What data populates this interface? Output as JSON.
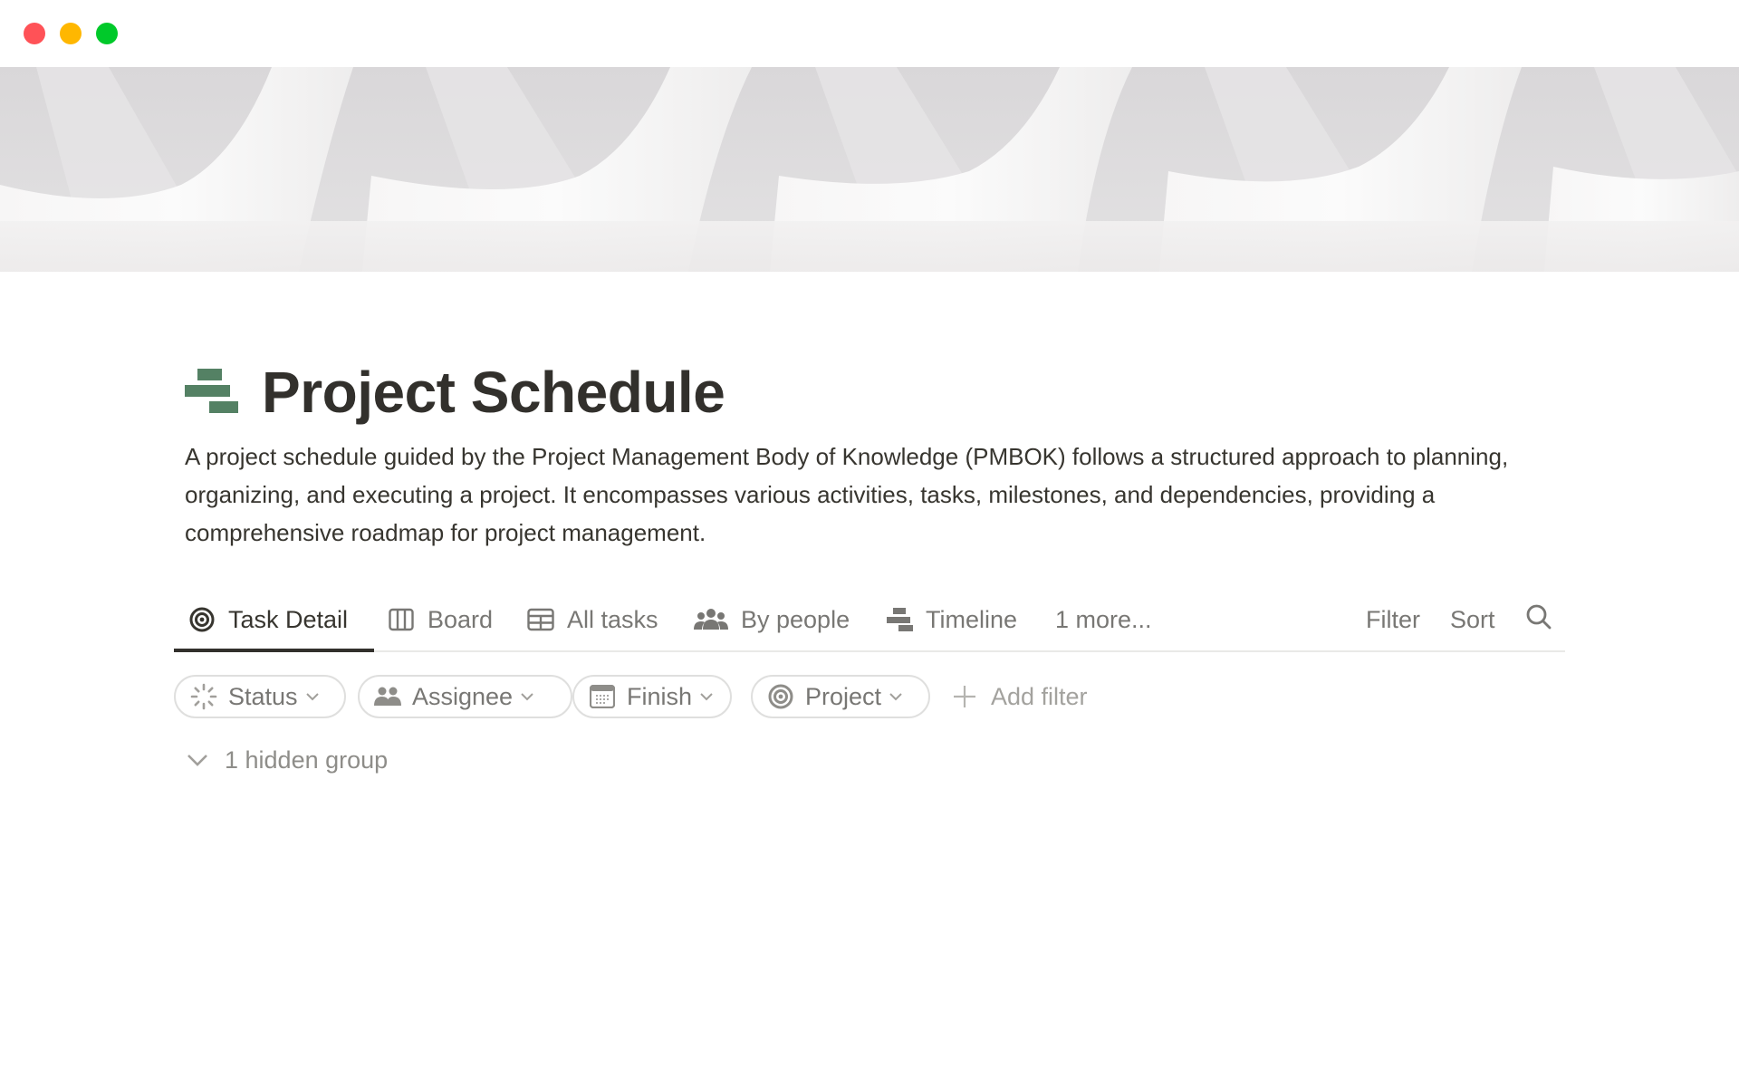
{
  "window": {
    "controls": [
      "close",
      "minimize",
      "maximize"
    ],
    "colors": {
      "close": "#ff5257",
      "minimize": "#ffb700",
      "maximize": "#00c92a"
    }
  },
  "cover": {
    "description": "White abstract sculptural arches"
  },
  "page": {
    "icon": "timeline-bars-icon",
    "icon_color": "#548164",
    "title": "Project Schedule",
    "description": "A project schedule guided by the Project Management Body of Knowledge (PMBOK) follows a structured approach to planning, organizing, and executing a project. It encompasses various activities, tasks, milestones, and dependencies, providing a comprehensive roadmap for project management."
  },
  "views": {
    "tabs": [
      {
        "label": "Task Detail",
        "icon": "target-icon",
        "active": true
      },
      {
        "label": "Board",
        "icon": "board-columns-icon",
        "active": false
      },
      {
        "label": "All tasks",
        "icon": "table-icon",
        "active": false
      },
      {
        "label": "By people",
        "icon": "people-icon",
        "active": false
      },
      {
        "label": "Timeline",
        "icon": "timeline-icon",
        "active": false
      }
    ],
    "more_label": "1 more...",
    "actions": {
      "filter": "Filter",
      "sort": "Sort",
      "search_icon": "search-icon"
    }
  },
  "filters": {
    "chips": [
      {
        "label": "Status",
        "icon": "status-spinner-icon"
      },
      {
        "label": "Assignee",
        "icon": "people-icon"
      },
      {
        "label": "Finish",
        "icon": "calendar-icon"
      },
      {
        "label": "Project",
        "icon": "target-icon"
      }
    ],
    "add_filter_label": "Add filter"
  },
  "groups": {
    "hidden_label": "1 hidden group"
  }
}
